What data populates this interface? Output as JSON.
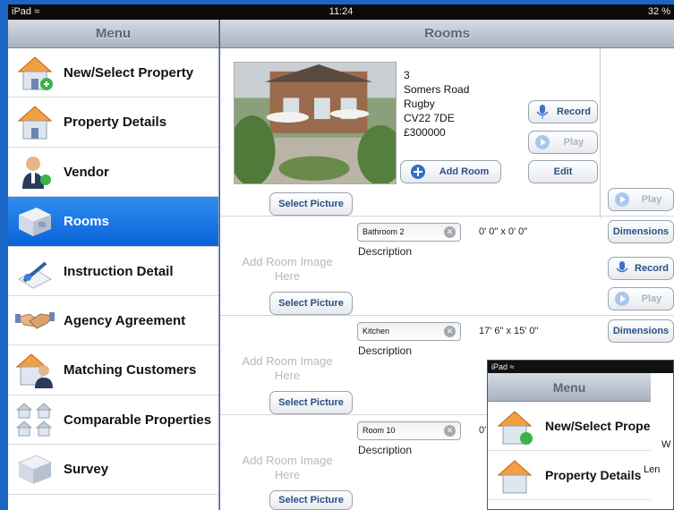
{
  "status_bar": {
    "device": "iPad",
    "wifi_icon": "wifi-icon",
    "time": "11:24",
    "battery": "32 %"
  },
  "sidebar": {
    "title": "Menu",
    "items": [
      {
        "label": "New/Select Property",
        "icon": "house-add-icon",
        "active": false
      },
      {
        "label": "Property Details",
        "icon": "house-icon",
        "active": false
      },
      {
        "label": "Vendor",
        "icon": "person-icon",
        "active": false
      },
      {
        "label": "Rooms",
        "icon": "room-icon",
        "active": true
      },
      {
        "label": "Instruction Detail",
        "icon": "pen-paper-icon",
        "active": false
      },
      {
        "label": "Agency Agreement",
        "icon": "handshake-icon",
        "active": false
      },
      {
        "label": "Matching Customers",
        "icon": "house-person-icon",
        "active": false
      },
      {
        "label": "Comparable Properties",
        "icon": "houses-grid-icon",
        "active": false
      },
      {
        "label": "Survey",
        "icon": "room-icon",
        "active": false
      }
    ]
  },
  "main": {
    "title": "Rooms",
    "property": {
      "address_lines": [
        "3",
        "Somers Road",
        "Rugby",
        "CV22 7DE",
        "£300000"
      ]
    },
    "buttons": {
      "record": "Record",
      "play": "Play",
      "add_room": "Add Room",
      "edit": "Edit",
      "select_picture": "Select Picture",
      "dimensions": "Dimensions"
    },
    "rooms": [
      {
        "name": "Bathroom 2",
        "description_label": "Description",
        "dimensions": "0' 0\" x 0' 0\"",
        "placeholder": "Add Room Image Here"
      },
      {
        "name": "Kitchen",
        "description_label": "Description",
        "dimensions": "17' 6\" x 15' 0\"",
        "placeholder": "Add Room Image Here"
      },
      {
        "name": "Room 10",
        "description_label": "Description",
        "dimensions": "0'",
        "placeholder": "Add Room Image Here"
      }
    ]
  },
  "inset": {
    "status": "iPad",
    "title": "Menu",
    "items": [
      "New/Select Prope",
      "Property Details"
    ],
    "dialog_text_1": "W",
    "dialog_text_2": "Len"
  },
  "colors": {
    "accent": "#0a63d8",
    "frame": "#1b65c4",
    "button_text": "#2b4f86"
  }
}
